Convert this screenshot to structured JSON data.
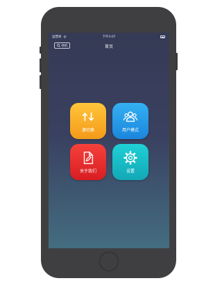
{
  "status_bar": {
    "carrier": "运营商",
    "time": "下午3:07"
  },
  "nav": {
    "search_label": "寻机",
    "title": "首页"
  },
  "tiles": [
    {
      "label": "源切换",
      "icon": "swap-arrows-icon",
      "color": "#f7ab26"
    },
    {
      "label": "用户模式",
      "icon": "users-icon",
      "color": "#2598e8"
    },
    {
      "label": "关于我们",
      "icon": "document-edit-icon",
      "color": "#e8302f"
    },
    {
      "label": "设置",
      "icon": "gear-icon",
      "color": "#18bcc6"
    }
  ]
}
